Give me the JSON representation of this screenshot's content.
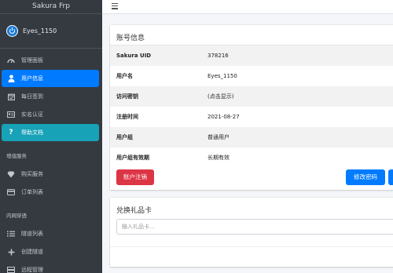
{
  "sidebar": {
    "brand": "Sakura Frp",
    "user": {
      "name": "Eyes_1150"
    },
    "items": [
      {
        "icon": "dashboard-icon",
        "label": "管理面板"
      },
      {
        "icon": "user-icon",
        "label": "用户信息"
      },
      {
        "icon": "calendar-check-icon",
        "label": "每日签到"
      },
      {
        "icon": "id-card-icon",
        "label": "实名认证"
      },
      {
        "icon": "question-icon",
        "label": "帮助文档"
      }
    ],
    "section_value_added": "增值服务",
    "value_added_items": [
      {
        "icon": "gem-icon",
        "label": "购买服务"
      },
      {
        "icon": "credit-card-icon",
        "label": "订单列表"
      }
    ],
    "section_tunnel": "内网穿透",
    "tunnel_items": [
      {
        "icon": "list-icon",
        "label": "隧道列表"
      },
      {
        "icon": "plus-icon",
        "label": "创建隧道"
      },
      {
        "icon": "server-icon",
        "label": "远程管理"
      }
    ]
  },
  "account": {
    "title": "账号信息",
    "rows": [
      {
        "label": "Sakura UID",
        "value": "378216"
      },
      {
        "label": "用户名",
        "value": "Eyes_1150"
      },
      {
        "label": "访问密钥",
        "value": "(点击显示)"
      },
      {
        "label": "注册时间",
        "value": "2021-08-27"
      },
      {
        "label": "用户组",
        "value": "普通用户"
      },
      {
        "label": "用户组有效期",
        "value": "长期有效"
      }
    ],
    "cancel_button": "账户注销",
    "change_password_button": "修改密码",
    "extra_button": ""
  },
  "gift": {
    "title": "兑换礼品卡",
    "placeholder": "输入礼品卡..."
  },
  "colors": {
    "sidebar_bg": "#343a40",
    "active": "#007bff",
    "info": "#17a2b8",
    "danger": "#dc3545"
  }
}
